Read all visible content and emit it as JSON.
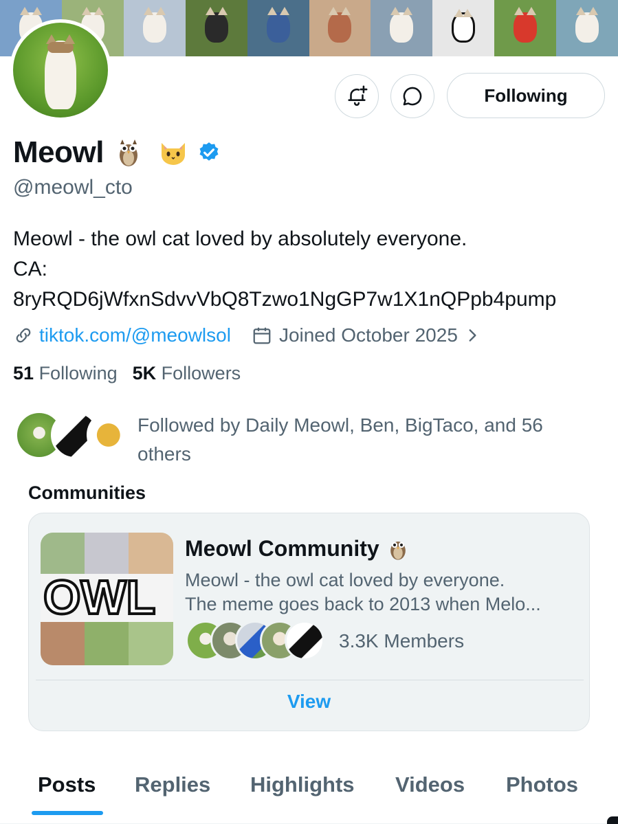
{
  "profile": {
    "display_name": "Meowl",
    "handle": "@meowl_cto",
    "bio_line1": "Meowl - the owl cat loved by absolutely everyone.",
    "bio_line2": "CA:",
    "bio_line3": "8ryRQD6jWfxnSdvvVbQ8Tzwo1NgGP7w1X1nQPpb4pump",
    "link": "tiktok.com/@meowlsol",
    "joined": "Joined October 2025",
    "verified": true
  },
  "actions": {
    "follow_label": "Following",
    "notify_icon": "bell-plus-icon",
    "message_icon": "message-bubble-icon"
  },
  "stats": {
    "following_count": "51",
    "following_label": "Following",
    "followers_count": "5K",
    "followers_label": "Followers"
  },
  "followed_by": {
    "text": "Followed by Daily Meowl, Ben, BigTaco, and 56 others"
  },
  "communities": {
    "title": "Communities",
    "card": {
      "name": "Meowl Community",
      "desc_line1": "Meowl - the owl cat loved by everyone.",
      "desc_line2": "The meme goes back to 2013 when Melo...",
      "members": "3.3K Members",
      "view_label": "View",
      "image_text": "OWL"
    }
  },
  "tabs": [
    {
      "label": "Posts",
      "active": true
    },
    {
      "label": "Replies",
      "active": false
    },
    {
      "label": "Highlights",
      "active": false
    },
    {
      "label": "Videos",
      "active": false
    },
    {
      "label": "Photos",
      "active": false
    }
  ],
  "colors": {
    "accent": "#1d9bf0",
    "text_primary": "#0f1419",
    "text_secondary": "#536471",
    "card_bg": "#eff3f4"
  }
}
